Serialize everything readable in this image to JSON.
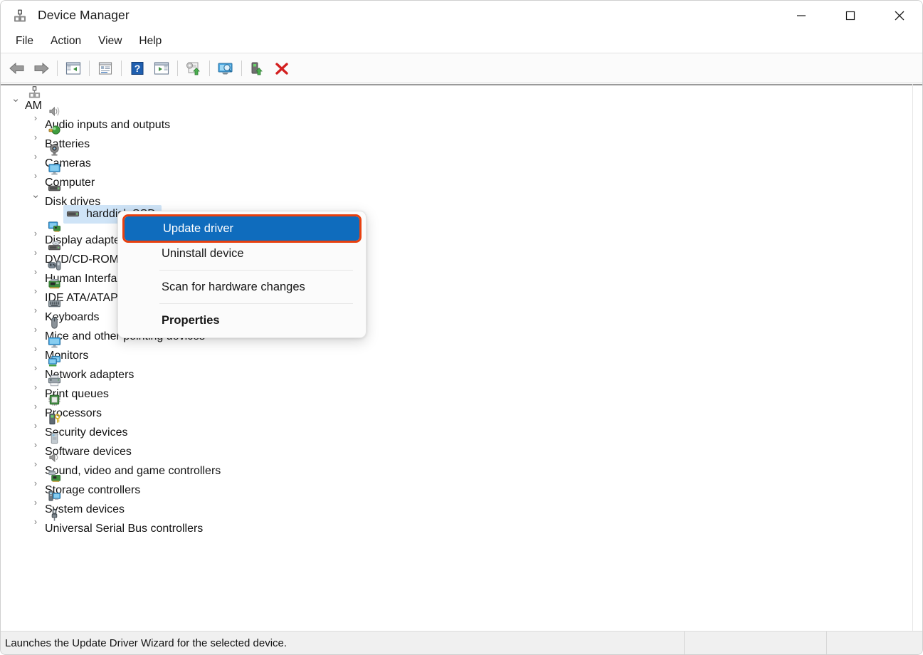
{
  "window": {
    "title": "Device Manager",
    "icon": "device-manager-icon",
    "controls": {
      "minimize": "—",
      "maximize": "□",
      "close": "✕"
    }
  },
  "menubar": {
    "items": [
      {
        "label": "File"
      },
      {
        "label": "Action"
      },
      {
        "label": "View"
      },
      {
        "label": "Help"
      }
    ]
  },
  "toolbar": {
    "buttons": [
      {
        "name": "back-icon",
        "title": "Back"
      },
      {
        "name": "forward-icon",
        "title": "Forward"
      },
      {
        "name": "show-hide-console-tree-icon",
        "title": "Show/Hide Console Tree"
      },
      {
        "name": "properties-icon",
        "title": "Properties"
      },
      {
        "name": "help-icon",
        "title": "Help"
      },
      {
        "name": "show-hide-action-pane-icon",
        "title": "Show/Hide Action Pane"
      },
      {
        "name": "update-driver-icon",
        "title": "Update Driver Software"
      },
      {
        "name": "scan-for-hardware-changes-icon",
        "title": "Scan for hardware changes"
      },
      {
        "name": "enable-device-icon",
        "title": "Enable device"
      },
      {
        "name": "uninstall-device-icon",
        "title": "Uninstall device"
      }
    ]
  },
  "tree": {
    "nodes": [
      {
        "label": "AM",
        "depth": 0,
        "expanded": true,
        "chevron": "⌄",
        "icon": "computer-root-icon",
        "selected": false
      },
      {
        "label": "Audio inputs and outputs",
        "depth": 1,
        "expanded": false,
        "chevron": "›",
        "icon": "audio-icon",
        "selected": false
      },
      {
        "label": "Batteries",
        "depth": 1,
        "expanded": false,
        "chevron": "›",
        "icon": "battery-icon",
        "selected": false
      },
      {
        "label": "Cameras",
        "depth": 1,
        "expanded": false,
        "chevron": "›",
        "icon": "camera-icon",
        "selected": false
      },
      {
        "label": "Computer",
        "depth": 1,
        "expanded": false,
        "chevron": "›",
        "icon": "computer-icon",
        "selected": false
      },
      {
        "label": "Disk drives",
        "depth": 1,
        "expanded": true,
        "chevron": "⌄",
        "icon": "disk-drive-icon",
        "selected": false
      },
      {
        "label": "harddisk SSD",
        "depth": 2,
        "expanded": false,
        "chevron": "",
        "icon": "disk-drive-icon",
        "selected": true
      },
      {
        "label": "Display adapters",
        "depth": 1,
        "expanded": false,
        "chevron": "›",
        "icon": "display-adapter-icon",
        "selected": false
      },
      {
        "label": "DVD/CD-ROM drives",
        "depth": 1,
        "expanded": false,
        "chevron": "›",
        "icon": "dvd-drive-icon",
        "selected": false
      },
      {
        "label": "Human Interface Devices",
        "depth": 1,
        "expanded": false,
        "chevron": "›",
        "icon": "hid-icon",
        "selected": false
      },
      {
        "label": "IDE ATA/ATAPI controllers",
        "depth": 1,
        "expanded": false,
        "chevron": "›",
        "icon": "ide-controller-icon",
        "selected": false
      },
      {
        "label": "Keyboards",
        "depth": 1,
        "expanded": false,
        "chevron": "›",
        "icon": "keyboard-icon",
        "selected": false
      },
      {
        "label": "Mice and other pointing devices",
        "depth": 1,
        "expanded": false,
        "chevron": "›",
        "icon": "mouse-icon",
        "selected": false
      },
      {
        "label": "Monitors",
        "depth": 1,
        "expanded": false,
        "chevron": "›",
        "icon": "monitor-icon",
        "selected": false
      },
      {
        "label": "Network adapters",
        "depth": 1,
        "expanded": false,
        "chevron": "›",
        "icon": "network-adapter-icon",
        "selected": false
      },
      {
        "label": "Print queues",
        "depth": 1,
        "expanded": false,
        "chevron": "›",
        "icon": "printer-icon",
        "selected": false
      },
      {
        "label": "Processors",
        "depth": 1,
        "expanded": false,
        "chevron": "›",
        "icon": "processor-icon",
        "selected": false
      },
      {
        "label": "Security devices",
        "depth": 1,
        "expanded": false,
        "chevron": "›",
        "icon": "security-device-icon",
        "selected": false
      },
      {
        "label": "Software devices",
        "depth": 1,
        "expanded": false,
        "chevron": "›",
        "icon": "software-device-icon",
        "selected": false
      },
      {
        "label": "Sound, video and game controllers",
        "depth": 1,
        "expanded": false,
        "chevron": "›",
        "icon": "sound-controller-icon",
        "selected": false
      },
      {
        "label": "Storage controllers",
        "depth": 1,
        "expanded": false,
        "chevron": "›",
        "icon": "storage-controller-icon",
        "selected": false
      },
      {
        "label": "System devices",
        "depth": 1,
        "expanded": false,
        "chevron": "›",
        "icon": "system-device-icon",
        "selected": false
      },
      {
        "label": "Universal Serial Bus controllers",
        "depth": 1,
        "expanded": false,
        "chevron": "›",
        "icon": "usb-icon",
        "selected": false
      }
    ]
  },
  "context_menu": {
    "items": [
      {
        "label": "Update driver",
        "type": "item",
        "highlighted": true,
        "bold": false
      },
      {
        "label": "Uninstall device",
        "type": "item",
        "highlighted": false,
        "bold": false
      },
      {
        "type": "separator"
      },
      {
        "label": "Scan for hardware changes",
        "type": "item",
        "highlighted": false,
        "bold": false
      },
      {
        "type": "separator"
      },
      {
        "label": "Properties",
        "type": "item",
        "highlighted": false,
        "bold": true
      }
    ]
  },
  "statusbar": {
    "message": "Launches the Update Driver Wizard for the selected device."
  },
  "colors": {
    "highlight_blue": "#0f6cbd",
    "annotation_red": "#e8400f",
    "selection_blue": "#cfe4f7",
    "window_bg": "#ffffff",
    "statusbar_bg": "#f0f0f0"
  }
}
